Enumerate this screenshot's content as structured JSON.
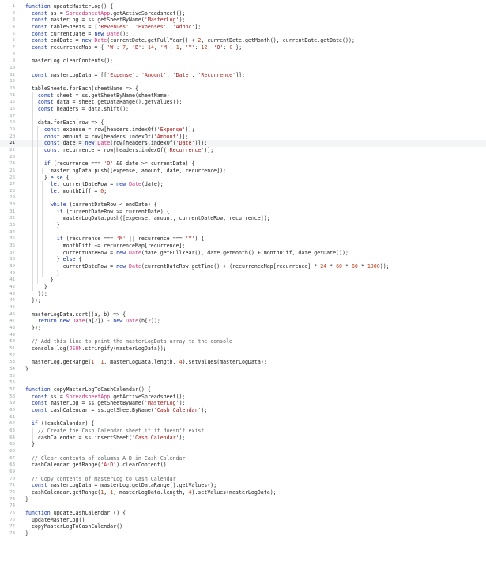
{
  "editor": {
    "lines": [
      "function updateMasterLog() {",
      "  const ss = SpreadsheetApp.getActiveSpreadsheet();",
      "  const masterLog = ss.getSheetByName('MasterLog');",
      "  const tableSheets = ['Revenues', 'Expenses', 'Adhoc'];",
      "  const currentDate = new Date();",
      "  const endDate = new Date(currentDate.getFullYear() + 2, currentDate.getMonth(), currentDate.getDate());",
      "  const recurrenceMap = { 'W': 7, 'B': 14, 'M': 1, 'Y': 12, 'O': 0 };",
      "",
      "  masterLog.clearContents();",
      "",
      "  const masterLogData = [['Expense', 'Amount', 'Date', 'Recurrence']];",
      "",
      "  tableSheets.forEach(sheetName => {",
      "    const sheet = ss.getSheetByName(sheetName);",
      "    const data = sheet.getDataRange().getValues();",
      "    const headers = data.shift();",
      "",
      "    data.forEach(row => {",
      "      const expense = row[headers.indexOf('Expense')];",
      "      const amount = row[headers.indexOf('Amount')];",
      "      const date = new Date(row[headers.indexOf('Date')]);",
      "      const recurrence = row[headers.indexOf('Recurrence')];",
      "",
      "      if (recurrence === 'O' && date >= currentDate) {",
      "        masterLogData.push([expense, amount, date, recurrence]);",
      "      } else {",
      "        let currentDateRow = new Date(date);",
      "        let monthDiff = 0;",
      "",
      "        while (currentDateRow < endDate) {",
      "          if (currentDateRow >= currentDate) {",
      "            masterLogData.push([expense, amount, currentDateRow, recurrence]);",
      "          }",
      "",
      "          if (recurrence === 'M' || recurrence === 'Y') {",
      "            monthDiff += recurrenceMap[recurrence];",
      "            currentDateRow = new Date(date.getFullYear(), date.getMonth() + monthDiff, date.getDate());",
      "          } else {",
      "            currentDateRow = new Date(currentDateRow.getTime() + (recurrenceMap[recurrence] * 24 * 60 * 60 * 1000));",
      "          }",
      "        }",
      "      }",
      "    });",
      "  });",
      "",
      "  masterLogData.sort((a, b) => {",
      "    return new Date(a[2]) - new Date(b[2]);",
      "  });",
      "",
      "  // Add this line to print the masterLogData array to the console",
      "  console.log(JSON.stringify(masterLogData));",
      "",
      "  masterLog.getRange(1, 1, masterLogData.length, 4).setValues(masterLogData);",
      "}",
      "",
      "",
      "function copyMasterLogToCashCalendar() {",
      "  const ss = SpreadsheetApp.getActiveSpreadsheet();",
      "  const masterLog = ss.getSheetByName('MasterLog');",
      "  const cashCalendar = ss.getSheetByName('Cash Calendar');",
      "",
      "  if (!cashCalendar) {",
      "    // Create the Cash Calendar sheet if it doesn't exist",
      "    cashCalendar = ss.insertSheet('Cash Calendar');",
      "  }",
      "",
      "  // Clear contents of columns A-D in Cash Calendar",
      "  cashCalendar.getRange('A:D').clearContent();",
      "",
      "  // Copy contents of MasterLog to Cash Calendar",
      "  const masterLogData = masterLog.getDataRange().getValues();",
      "  cashCalendar.getRange(1, 1, masterLogData.length, 4).setValues(masterLogData);",
      "}",
      "",
      "function updateCashCalendar () {",
      "  updateMasterLog()",
      "  copyMasterLogToCashCalendar()",
      "}"
    ],
    "active_line": 21,
    "colors": {
      "keyword": "#0b2fa3",
      "string": "#a31515",
      "number": "#b93a10",
      "class": "#d12e7d",
      "comment": "#5f6368",
      "line_number": "#9aa0a6",
      "active_line_bg": "#f3f5f7"
    }
  }
}
